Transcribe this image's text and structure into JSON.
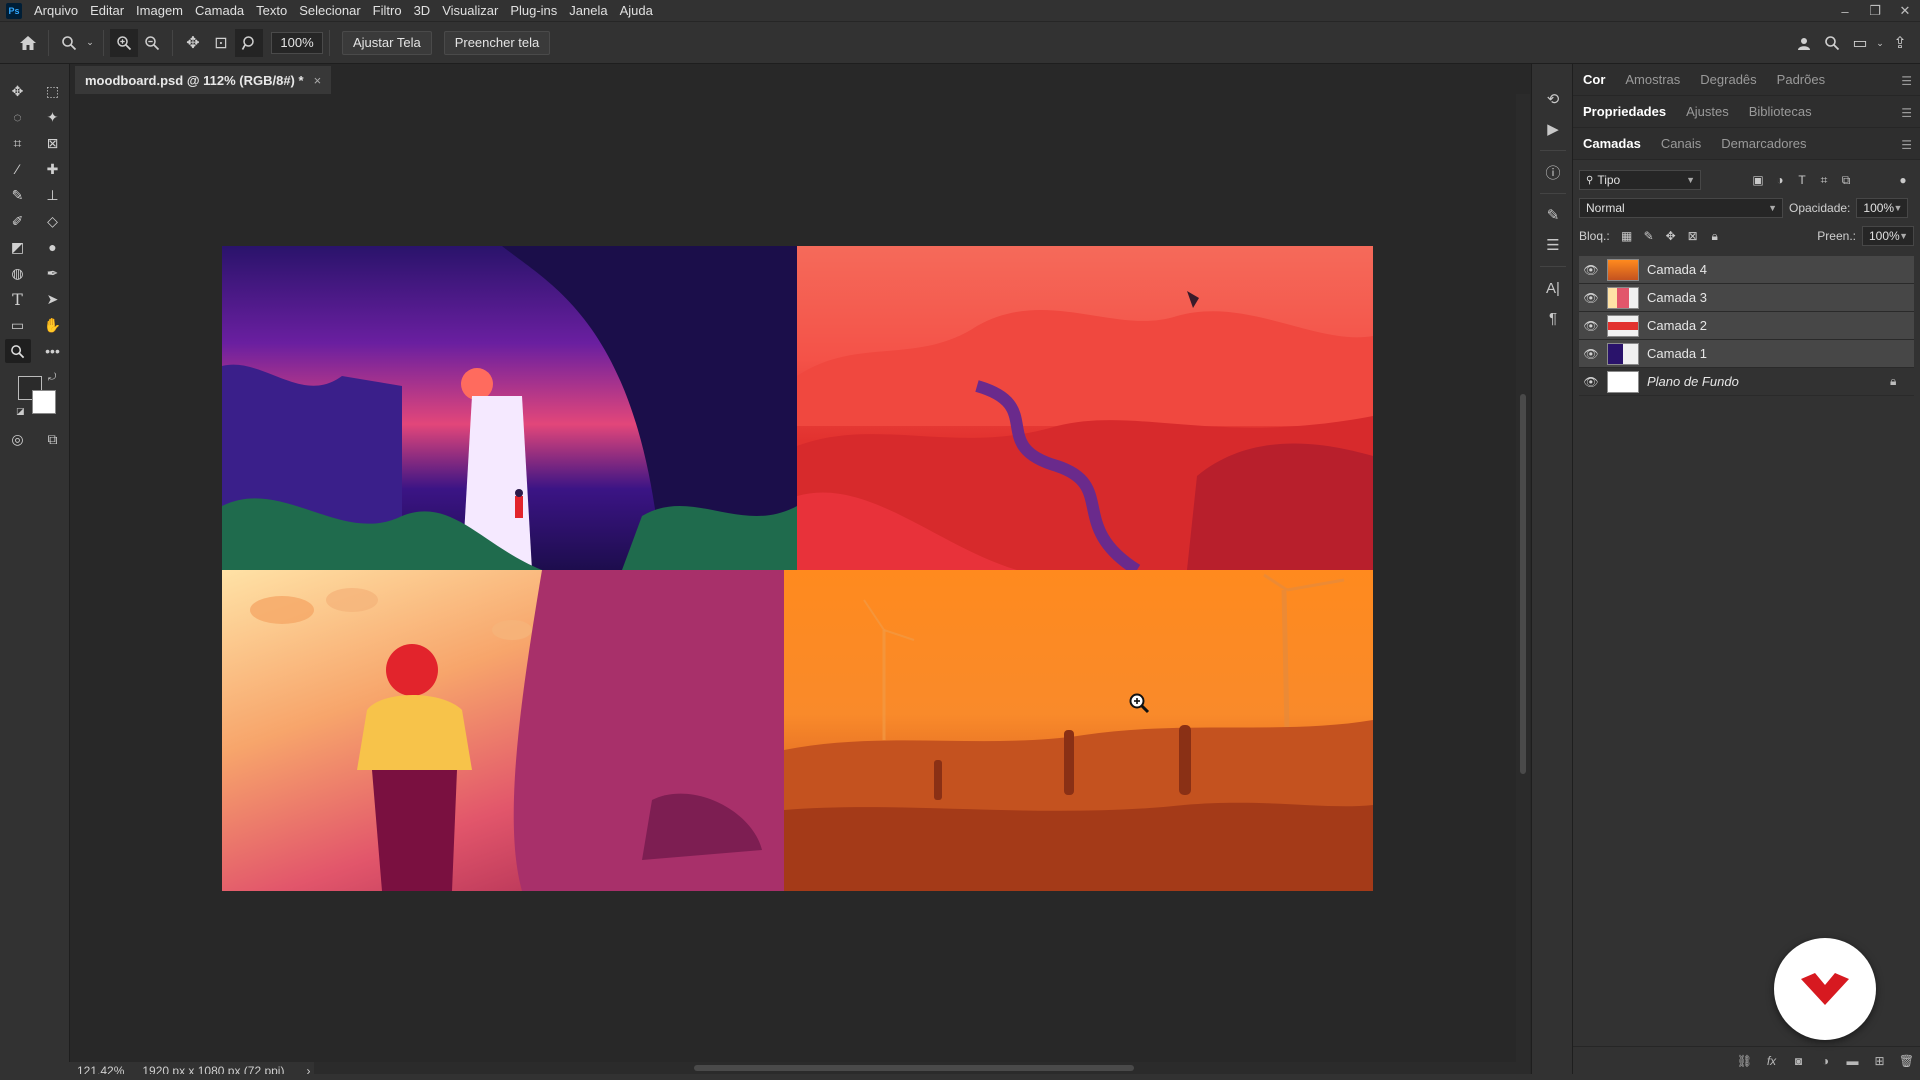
{
  "app": {
    "logo": "Ps"
  },
  "menu": [
    "Arquivo",
    "Editar",
    "Imagem",
    "Camada",
    "Texto",
    "Selecionar",
    "Filtro",
    "3D",
    "Visualizar",
    "Plug-ins",
    "Janela",
    "Ajuda"
  ],
  "options": {
    "zoom_value": "100%",
    "fit_button": "Ajustar Tela",
    "fill_button": "Preencher tela"
  },
  "document": {
    "tab_title": "moodboard.psd @ 112% (RGB/8#) *",
    "close": "×"
  },
  "status": {
    "zoom": "121,42%",
    "size": "1920 px x 1080 px (72 ppi)",
    "arrow": "›"
  },
  "panels": {
    "top_tabs": [
      "Cor",
      "Amostras",
      "Degradês",
      "Padrões"
    ],
    "mid_tabs": [
      "Propriedades",
      "Ajustes",
      "Bibliotecas"
    ],
    "layer_tabs": [
      "Camadas",
      "Canais",
      "Demarcadores"
    ],
    "filter": "Tipo",
    "blend_mode": "Normal",
    "opacity_label": "Opacidade:",
    "opacity_value": "100%",
    "lock_label": "Bloq.:",
    "fill_label": "Preen.:",
    "fill_value": "100%"
  },
  "layers": [
    {
      "name": "Camada 4",
      "selected": true
    },
    {
      "name": "Camada 3",
      "selected": true
    },
    {
      "name": "Camada 2",
      "selected": true
    },
    {
      "name": "Camada 1",
      "selected": true
    },
    {
      "name": "Plano de Fundo",
      "selected": false,
      "locked": true
    }
  ],
  "colors": {
    "accent_red": "#d71920",
    "panel_bg": "#323232",
    "canvas_bg": "#282828"
  }
}
